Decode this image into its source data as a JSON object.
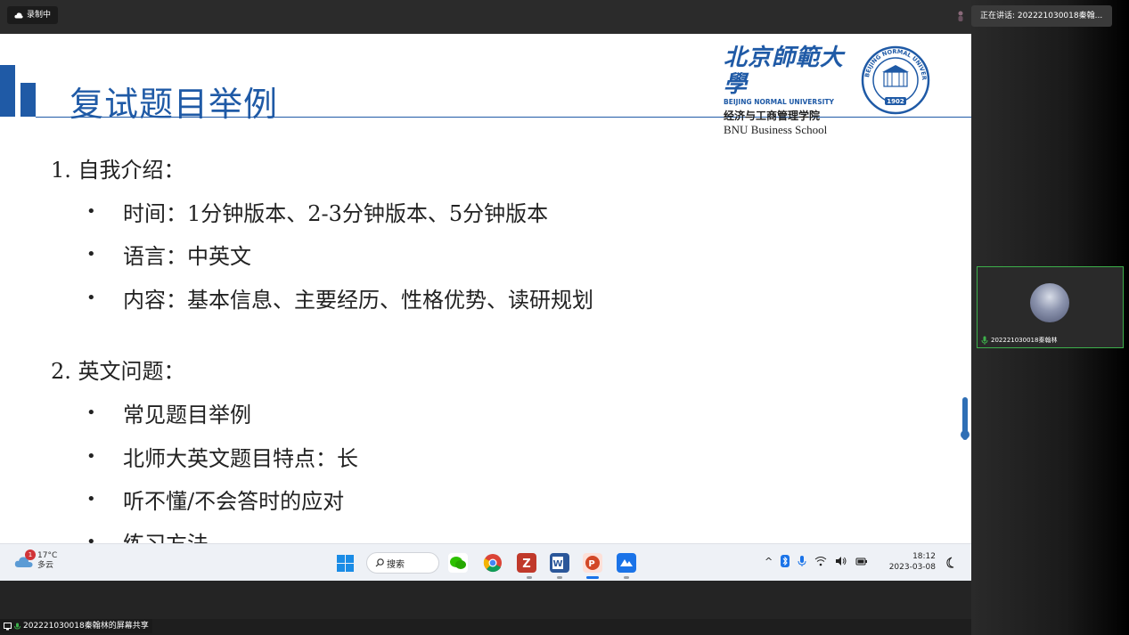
{
  "meeting": {
    "recording_label": "录制中",
    "speaking_label": "正在讲话: 202221030018秦翰...",
    "participant_name": "202221030018秦翰林",
    "share_label": "202221030018秦翰林的屏幕共享"
  },
  "slide": {
    "title": "复试题目举例",
    "logo": {
      "calligraphy": "北京師範大學",
      "en": "BEIJING NORMAL UNIVERSITY",
      "cn": "经济与工商管理学院",
      "school": "BNU Business School",
      "seal_year": "1902",
      "seal_text": "BEIJING NORMAL UNIVERSITY"
    },
    "sections": [
      {
        "heading": "1.  自我介绍：",
        "bullets": [
          "时间：1分钟版本、2-3分钟版本、5分钟版本",
          "语言：中英文",
          "内容：基本信息、主要经历、性格优势、读研规划"
        ]
      },
      {
        "heading": "2.  英文问题：",
        "bullets": [
          "常见题目举例",
          "北师大英文题目特点：长",
          "听不懂/不会答时的应对",
          "练习方法"
        ]
      }
    ]
  },
  "taskbar": {
    "weather_temp": "17°C",
    "weather_desc": "多云",
    "weather_badge": "1",
    "search_label": "搜索",
    "time": "18:12",
    "date": "2023-03-08",
    "tray_caret": "^"
  },
  "colors": {
    "accent": "#1f5aa6",
    "active_border": "#3db04b"
  }
}
